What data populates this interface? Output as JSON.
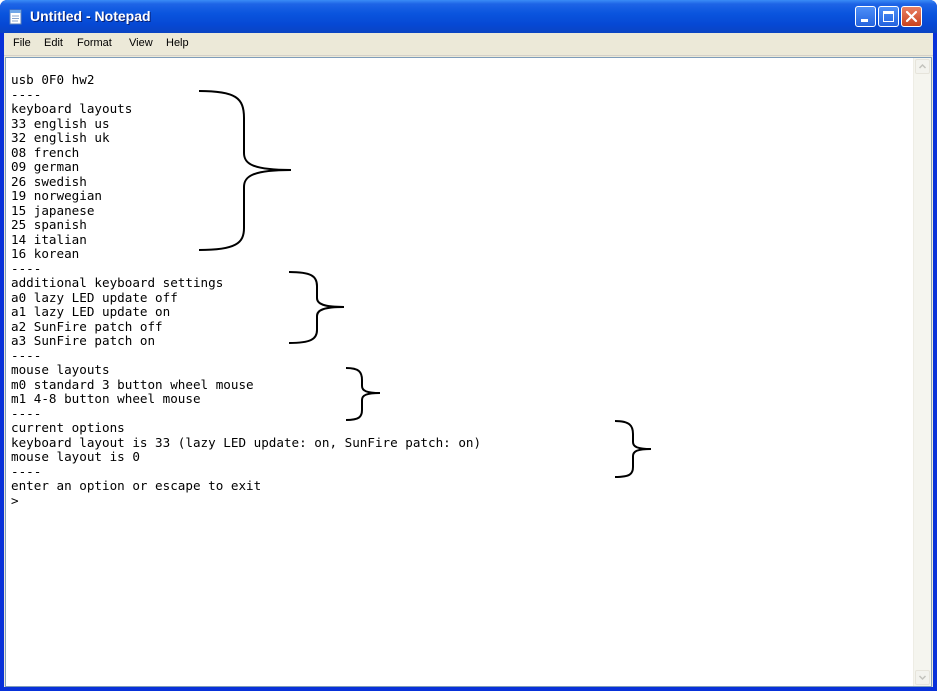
{
  "window": {
    "title": "Untitled - Notepad",
    "icon": "notepad-icon",
    "title_color": "#ffffff",
    "titlebar_color": "#0a55de"
  },
  "menubar": {
    "items": [
      {
        "label": "File"
      },
      {
        "label": "Edit"
      },
      {
        "label": "Format"
      },
      {
        "label": "View"
      },
      {
        "label": "Help"
      }
    ]
  },
  "document": {
    "lines": [
      "usb 0F0 hw2",
      "----",
      "keyboard layouts",
      "33 english us",
      "32 english uk",
      "08 french",
      "09 german",
      "26 swedish",
      "19 norwegian",
      "15 japanese",
      "25 spanish",
      "14 italian",
      "16 korean",
      "----",
      "additional keyboard settings",
      "a0 lazy LED update off",
      "a1 lazy LED update on",
      "a2 SunFire patch off",
      "a3 SunFire patch on",
      "----",
      "mouse layouts",
      "m0 standard 3 button wheel mouse",
      "m1 4-8 button wheel mouse",
      "----",
      "current options",
      "keyboard layout is 33 (lazy LED update: on, SunFire patch: on)",
      "mouse layout is 0",
      "----",
      "enter an option or escape to exit",
      ">"
    ]
  },
  "annotations": {
    "brace_groups": [
      "keyboard-layouts-brace",
      "keyboard-settings-brace",
      "mouse-layouts-brace",
      "current-options-brace"
    ]
  },
  "controls": {
    "minimize_icon": "minimize-icon",
    "maximize_icon": "maximize-icon",
    "close_icon": "close-icon"
  }
}
